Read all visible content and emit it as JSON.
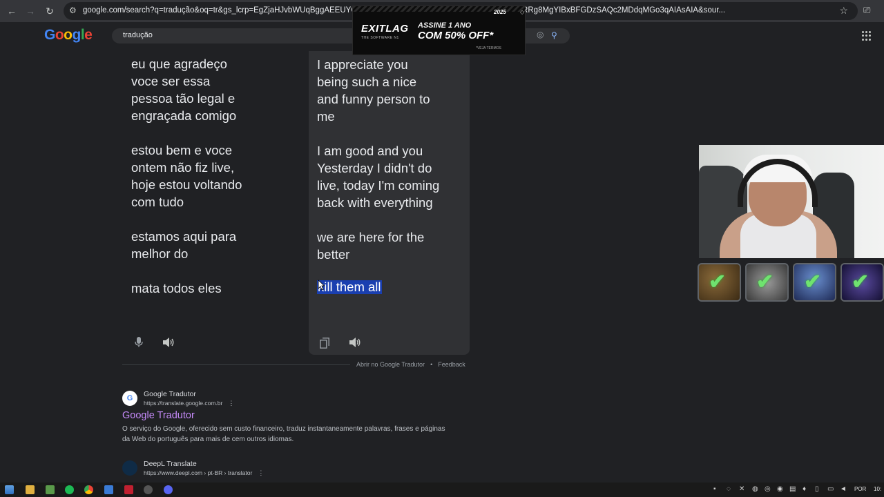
{
  "browser": {
    "url": "google.com/search?q=tradução&oq=tr&gs_lcrp=EgZjaHJvbWUqBggAEEUYOzIGC...MgYIBBBFGDsyBggFEEUYOzIGCAYQRRg8MgYIBxBFGDzSAQc2MDdqMGo3qAIAsAIA&sour..."
  },
  "google": {
    "logo": "Google",
    "query": "tradução"
  },
  "ad": {
    "brand": "EXITLAG",
    "subtitle": "THE SOFTWARE N1",
    "line1": "ASSINE 1 ANO",
    "line2": "COM 50% OFF*",
    "fineprint": "*VEJA TERMOS",
    "badge": "2025"
  },
  "translator": {
    "source_text": "eu que agradeço\nvoce ser essa\npessoa tão legal e\nengraçada comigo\n\nestou bem e voce\nontem não fiz live,\nhoje estou voltando\ncom tudo\n\nestamos aqui para\nmelhor do\n\nmata todos eles",
    "target_text": "I appreciate you\nbeing such a nice\nand funny person to\nme\n\nI am good and you\nYesterday I didn't do\nlive, today I'm coming\nback with everything\n\nwe are here for the\nbetter",
    "target_selected": "kill them all",
    "open_link": "Abrir no Google Tradutor",
    "feedback": "Feedback"
  },
  "results": [
    {
      "site": "Google Tradutor",
      "url": "https://translate.google.com.br",
      "title": "Google Tradutor",
      "snippet": "O serviço do Google, oferecido sem custo financeiro, traduz instantaneamente palavras, frases e páginas da Web do português para mais de cem outros idiomas."
    },
    {
      "site": "DeepL Translate",
      "url": "https://www.deepl.com › pt-BR › translator"
    }
  ],
  "taskbar": {
    "lang": "POR",
    "time": "10:"
  }
}
